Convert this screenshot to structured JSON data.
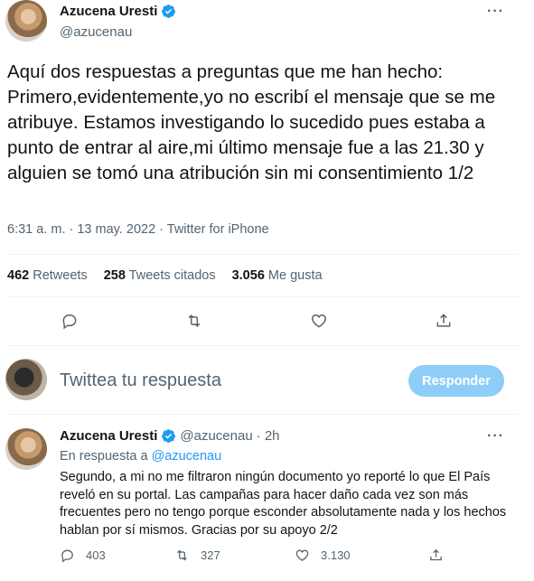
{
  "tweet": {
    "author_name": "Azucena Uresti",
    "author_handle": "@azucenau",
    "text": "Aquí dos respuestas a preguntas que me han hecho: Primero,evidentemente,yo no escribí el mensaje que se me atribuye. Estamos investigando lo sucedido pues estaba a punto de entrar al aire,mi último mensaje fue a las 21.30 y alguien se tomó una atribución sin mi consentimiento 1/2",
    "timestamp": "6:31 a. m. · 13 may. 2022 · Twitter for iPhone",
    "stats": {
      "retweets_count": "462",
      "retweets_label": "Retweets",
      "quotes_count": "258",
      "quotes_label": "Tweets citados",
      "likes_count": "3.056",
      "likes_label": "Me gusta"
    }
  },
  "composer": {
    "placeholder": "Twittea tu respuesta",
    "button_label": "Responder"
  },
  "reply": {
    "author_name": "Azucena Uresti",
    "author_handle": "@azucenau",
    "time": "· 2h",
    "in_reply_prefix": "En respuesta a",
    "in_reply_handle": "@azucenau",
    "text": "Segundo, a mi no me filtraron ningún documento yo reporté lo que El País reveló en su portal. Las campañas para hacer daño cada vez son más frecuentes pero no tengo porque esconder absolutamente nada y los hechos hablan por sí mismos. Gracias por su apoyo 2/2",
    "replies": "403",
    "retweets": "327",
    "likes": "3.130"
  },
  "colors": {
    "accent": "#1d9bf0",
    "button_disabled": "#8ecdf8",
    "secondary_text": "#536471"
  },
  "icons": [
    "verified-badge-icon",
    "more-icon",
    "reply-icon",
    "retweet-icon",
    "like-icon",
    "share-icon"
  ]
}
